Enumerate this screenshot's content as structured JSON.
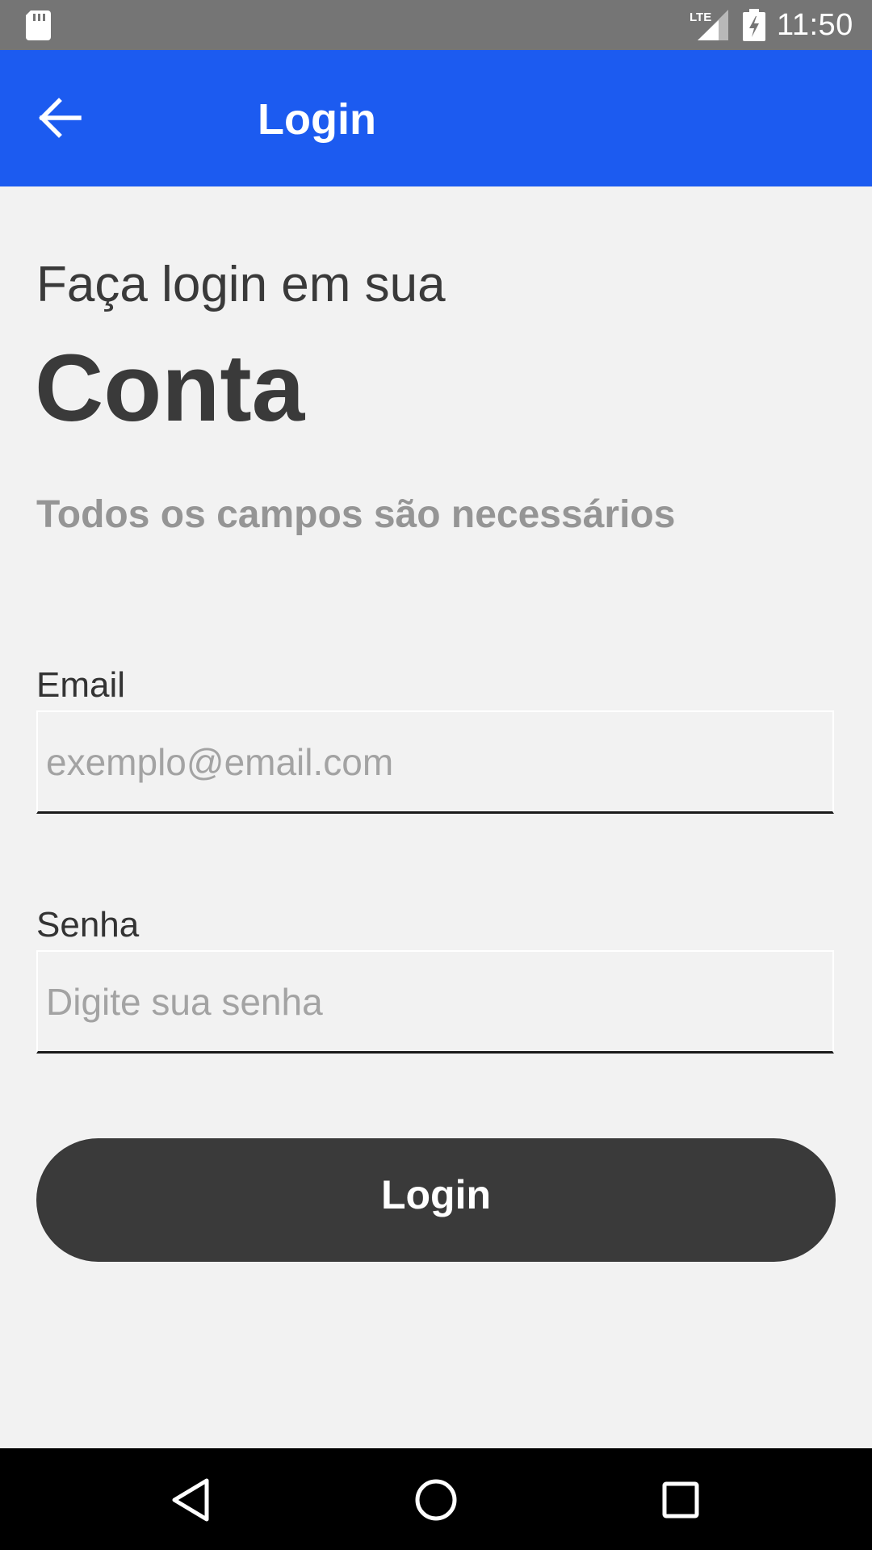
{
  "status_bar": {
    "time": "11:50",
    "network": "LTE",
    "icons": [
      "sd-card-icon",
      "lte-signal-icon",
      "battery-charging-icon"
    ]
  },
  "app_bar": {
    "title": "Login",
    "back_icon": "arrow-back-icon"
  },
  "content": {
    "heading_line1": "Faça login em sua",
    "heading_line2": "Conta",
    "subtitle": "Todos os campos são necessários"
  },
  "form": {
    "email": {
      "label": "Email",
      "value": "",
      "placeholder": "exemplo@email.com"
    },
    "password": {
      "label": "Senha",
      "value": "",
      "placeholder": "Digite sua senha"
    },
    "submit_label": "Login"
  },
  "nav_bar": {
    "icons": [
      "nav-back-icon",
      "nav-home-icon",
      "nav-recents-icon"
    ]
  },
  "colors": {
    "app_bar": "#1c5bf0",
    "status_bar": "#757575",
    "background": "#f2f2f2",
    "button": "#3a3a3a",
    "subtitle": "#959595",
    "placeholder": "#a3a3a3"
  }
}
